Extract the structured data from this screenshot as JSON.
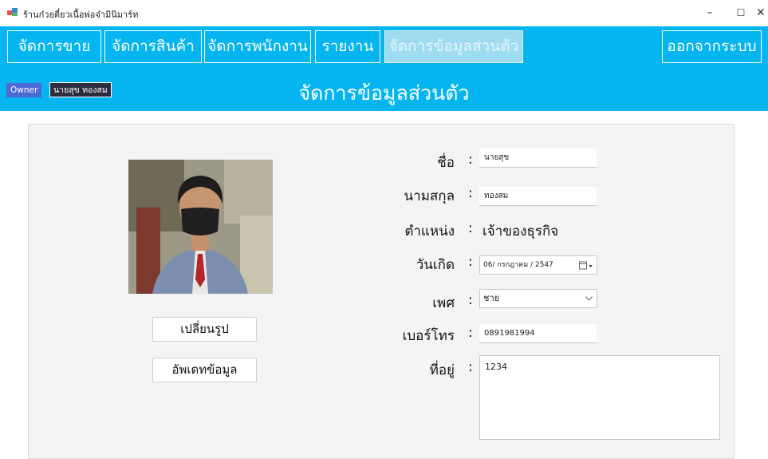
{
  "window": {
    "title": "ร้านก๋วยตี๋ยวเนื้อพ่อจ๋ามินิมาร์ท",
    "minimize": "–",
    "maximize": "☐",
    "close": "✕"
  },
  "menu": {
    "items": [
      {
        "label": "จัดการขาย",
        "active": false
      },
      {
        "label": "จัดการสินค้า",
        "active": false
      },
      {
        "label": "จัดการพนักงาน",
        "active": false
      },
      {
        "label": "รายงาน",
        "active": false
      },
      {
        "label": "จัดการข้อมูลส่วนตัว",
        "active": true
      }
    ],
    "logout_label": "ออกจากระบบ"
  },
  "header": {
    "role": "Owner",
    "user_name": "นายสุข ทองสม",
    "title": "จัดการข้อมูลส่วนตัว"
  },
  "profile": {
    "change_photo_label": "เปลี่ยนรูป",
    "update_label": "อัพเดทข้อมูล"
  },
  "form": {
    "colon": ":",
    "first_name_label": "ชื่อ",
    "first_name_value": "นายสุข",
    "last_name_label": "นามสกุล",
    "last_name_value": "ทองสม",
    "position_label": "ตำแหน่ง",
    "position_value": "เจ้าของธุรกิจ",
    "birthdate_label": "วันเกิด",
    "birthdate_value": "06/ กรกฎาคม / 2547",
    "gender_label": "เพศ",
    "gender_value": "ชาย",
    "phone_label": "เบอร์โทร",
    "phone_value": "0891981994",
    "address_label": "ที่อยู่",
    "address_value": "1234"
  },
  "colors": {
    "accent": "#04b5ef",
    "menu_active_bg": "#9fdcf1",
    "role_badge": "#4b6ad3",
    "name_badge": "#2d2d40"
  }
}
